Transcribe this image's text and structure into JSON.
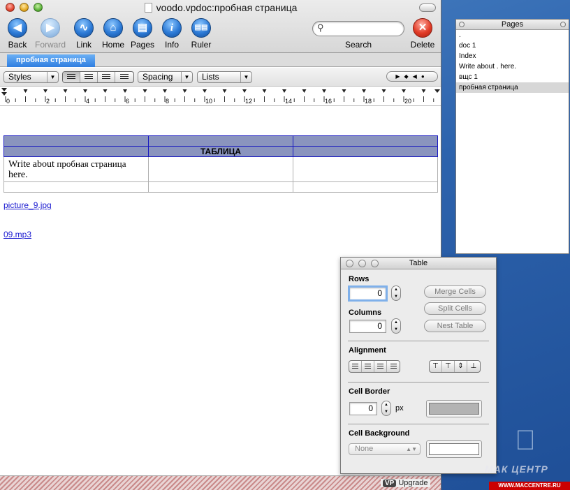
{
  "window": {
    "title": "voodo.vpdoc:пробная страница"
  },
  "toolbar": {
    "back": "Back",
    "forward": "Forward",
    "link": "Link",
    "home": "Home",
    "pages": "Pages",
    "info": "Info",
    "ruler": "Ruler",
    "search_label": "Search",
    "search_value": "",
    "delete": "Delete",
    "icons": {
      "back": "left-arrow-icon",
      "forward": "right-arrow-icon",
      "link": "link-icon",
      "home": "home-icon",
      "pages": "pages-icon",
      "info": "info-icon",
      "ruler": "ruler-icon",
      "delete": "close-icon"
    }
  },
  "tabs": [
    {
      "label": "пробная страница",
      "active": true
    }
  ],
  "format_bar": {
    "styles": "Styles",
    "spacing": "Spacing",
    "lists": "Lists"
  },
  "ruler": {
    "labels": [
      "0",
      "2",
      "4",
      "6",
      "8",
      "10",
      "12",
      "14",
      "16",
      "18",
      "20"
    ]
  },
  "document": {
    "table_header": "ТАБЛИЦА",
    "cell_text_a": "Write about",
    "cell_text_b": "пробная страница",
    "cell_text_c": "here.",
    "links": [
      "picture_9.jpg",
      "09.mp3"
    ]
  },
  "statusbar": {
    "upgrade_badge": "VP",
    "upgrade_label": "Upgrade"
  },
  "pages_panel": {
    "title": "Pages",
    "items": [
      {
        "label": ".",
        "selected": false
      },
      {
        "label": "doc 1",
        "selected": false
      },
      {
        "label": "Index",
        "selected": false
      },
      {
        "label": "Write about . here.",
        "selected": false
      },
      {
        "label": "вщс 1",
        "selected": false
      },
      {
        "label": "пробная страница",
        "selected": true
      }
    ]
  },
  "table_palette": {
    "title": "Table",
    "rows_label": "Rows",
    "rows_value": "0",
    "columns_label": "Columns",
    "columns_value": "0",
    "merge_cells": "Merge Cells",
    "split_cells": "Split Cells",
    "nest_table": "Nest Table",
    "alignment_label": "Alignment",
    "cell_border_label": "Cell Border",
    "cell_border_value": "0",
    "cell_border_unit": "px",
    "cell_background_label": "Cell Background",
    "cell_background_value": "None",
    "border_color": "#b3b3b3",
    "background_color": "#ffffff"
  },
  "desktop": {
    "watermark_logo": "МАК ЦЕНТР",
    "watermark_url": "WWW.MACCENTRE.RU"
  }
}
